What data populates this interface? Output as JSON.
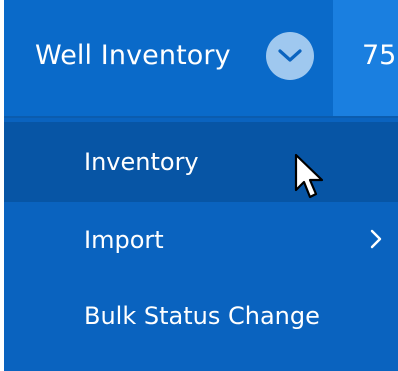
{
  "header": {
    "title": "Well Inventory",
    "expand_icon": "chevron-down-icon",
    "next_tab_text": "75"
  },
  "menu": {
    "items": [
      {
        "label": "Inventory",
        "hovered": true
      },
      {
        "label": "Import",
        "has_submenu": true,
        "submenu_icon": "chevron-right-icon"
      },
      {
        "label": "Bulk Status Change"
      }
    ]
  },
  "cursor": {
    "icon": "mouse-pointer-icon"
  },
  "colors": {
    "header_bg": "#0a6ac9",
    "menu_bg": "#0a63bf",
    "hover_bg": "#0755a5",
    "chevron_circle": "#9fc8ef",
    "next_tab_bg": "#1a7fe0",
    "text": "#ffffff"
  }
}
